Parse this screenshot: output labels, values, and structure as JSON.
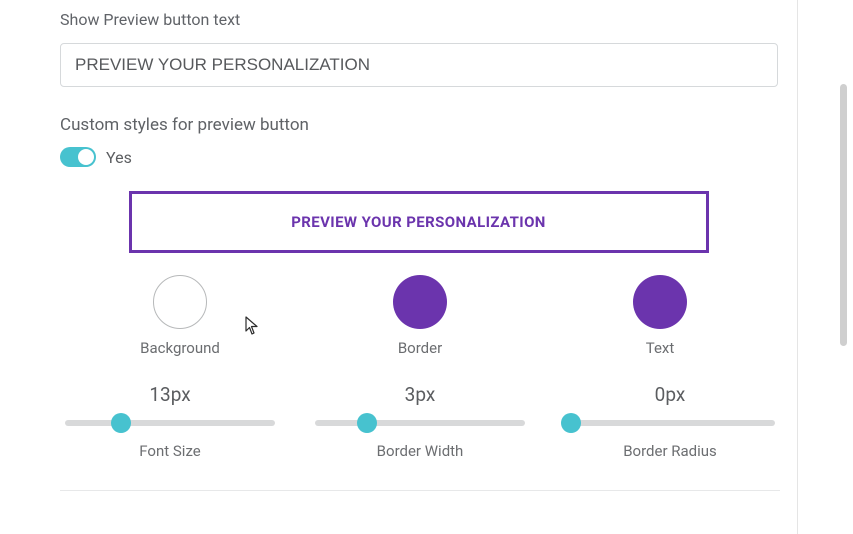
{
  "button_text": {
    "field_label": "Show Preview button text",
    "value": "PREVIEW YOUR PERSONALIZATION"
  },
  "custom_styles": {
    "label": "Custom styles for preview button",
    "enabled_label": "Yes"
  },
  "preview": {
    "label": "PREVIEW YOUR PERSONALIZATION"
  },
  "swatches": {
    "background": {
      "label": "Background"
    },
    "border": {
      "label": "Border"
    },
    "text": {
      "label": "Text"
    }
  },
  "sliders": {
    "font_size": {
      "value": "13px",
      "label": "Font Size"
    },
    "border_width": {
      "value": "3px",
      "label": "Border Width"
    },
    "border_radius": {
      "value": "0px",
      "label": "Border Radius"
    }
  }
}
